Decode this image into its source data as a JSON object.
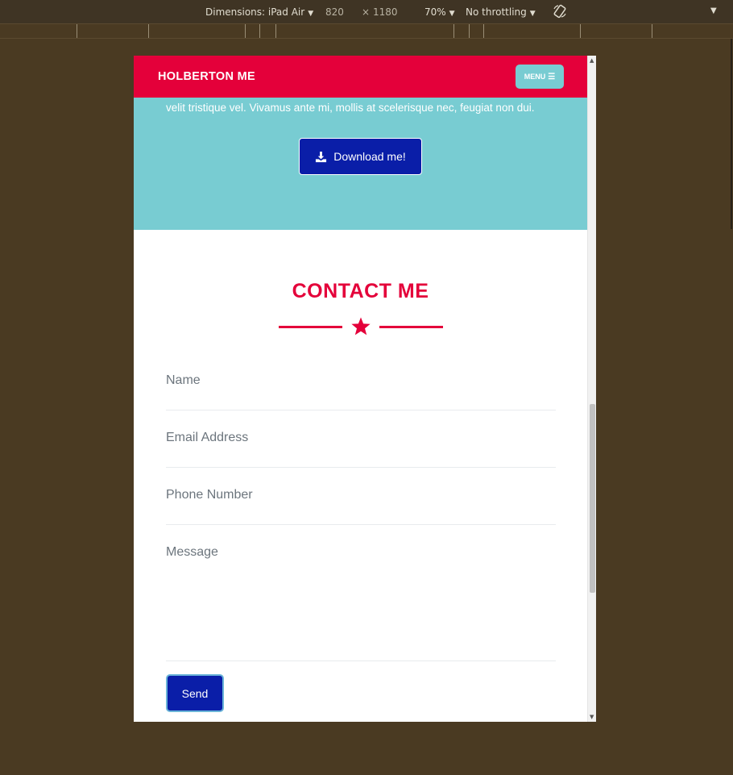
{
  "devtools": {
    "dimensions_label": "Dimensions: iPad Air",
    "width": "820",
    "times": "×",
    "height": "1180",
    "zoom": "70%",
    "throttling": "No throttling",
    "caret": "▼",
    "rotate_icon": "rotate-icon",
    "more_icon": "▼"
  },
  "page": {
    "brand": "HOLBERTON ME",
    "menu_label": "MENU",
    "menu_icon": "☰",
    "hero_text": "velit tristique vel. Vivamus ante mi, mollis at scelerisque nec, feugiat non dui.",
    "download_label": "Download me!",
    "contact_title": "CONTACT ME",
    "form": {
      "name_placeholder": "Name",
      "email_placeholder": "Email Address",
      "phone_placeholder": "Phone Number",
      "message_placeholder": "Message",
      "send_label": "Send"
    }
  },
  "colors": {
    "primary": "#e4003a",
    "secondary": "#78ccd2",
    "button": "#0a1ea8",
    "devtools_bg": "#4a3a22"
  }
}
